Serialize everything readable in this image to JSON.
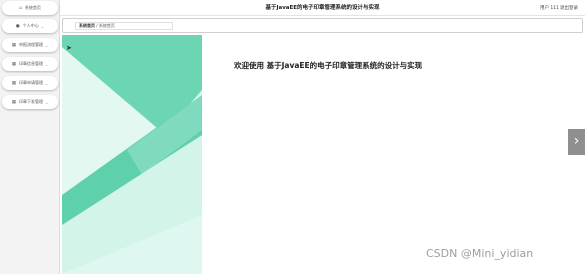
{
  "header": {
    "title": "基于JavaEE的电子印章管理系统的设计与实现",
    "user_text": "用户 111",
    "logout_label": "退出登录"
  },
  "sidebar": {
    "items": [
      {
        "label": "系统首页",
        "icon": "home-icon",
        "has_dropdown": false
      },
      {
        "label": "个人中心",
        "icon": "user-icon",
        "has_dropdown": true
      },
      {
        "label": "申报流程管理",
        "icon": "menu-icon",
        "has_dropdown": true
      },
      {
        "label": "印章信息管理",
        "icon": "menu-icon",
        "has_dropdown": true
      },
      {
        "label": "印章申请管理",
        "icon": "menu-icon",
        "has_dropdown": true
      },
      {
        "label": "印章下发管理",
        "icon": "menu-icon",
        "has_dropdown": true
      }
    ]
  },
  "breadcrumb": {
    "root": "系统首页",
    "separator": "/",
    "current": "系统首页"
  },
  "main": {
    "welcome": "欢迎使用 基于JavaEE的电子印章管理系统的设计与实现"
  },
  "carousel": {
    "next_glyph": "›"
  },
  "watermark": "CSDN @Mini_yidian",
  "colors": {
    "banner_light": "#d8f6ee",
    "banner_green": "#5fd0ac",
    "banner_mid": "#86dcc2"
  }
}
